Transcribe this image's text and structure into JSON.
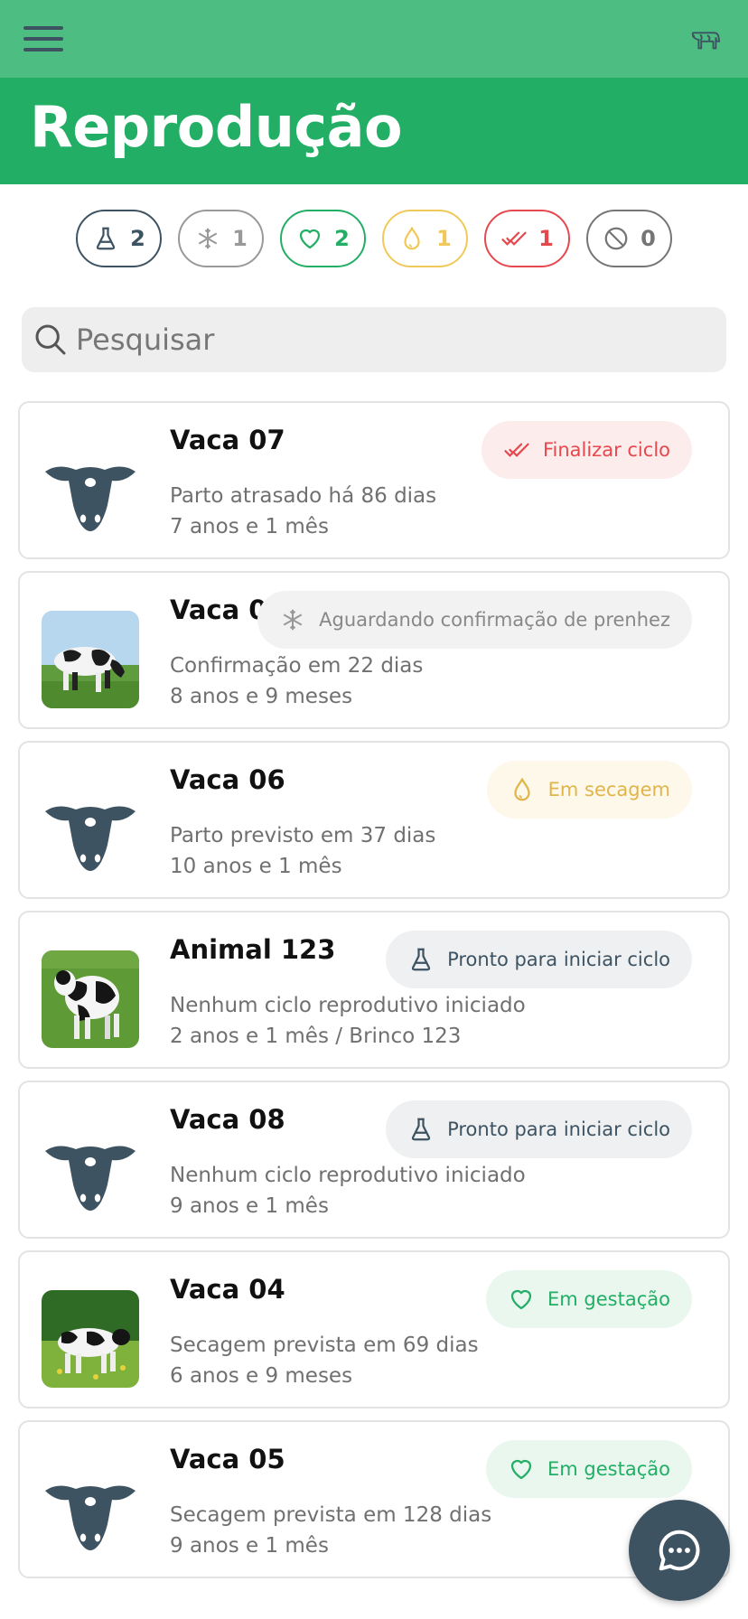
{
  "app": {
    "title": "Reprodução"
  },
  "search": {
    "placeholder": "Pesquisar"
  },
  "filters": [
    {
      "icon": "flask-icon",
      "count": "2",
      "color": "#3e5362"
    },
    {
      "icon": "snowflake-icon",
      "count": "1",
      "color": "#999999"
    },
    {
      "icon": "heart-icon",
      "count": "2",
      "color": "#23ae65"
    },
    {
      "icon": "drop-icon",
      "count": "1",
      "color": "#f0c95a"
    },
    {
      "icon": "double-check-icon",
      "count": "1",
      "color": "#e5484d"
    },
    {
      "icon": "ban-icon",
      "count": "0",
      "color": "#757575"
    }
  ],
  "animals": [
    {
      "name": "Vaca 07",
      "line1": "Parto atrasado há 86 dias",
      "line2": "7 anos e 1 mês",
      "status": "Finalizar ciclo",
      "status_icon": "double-check-icon",
      "photo": "cow-silhouette"
    },
    {
      "name": "Vaca 02",
      "line1": "Confirmação em 22 dias",
      "line2": "8 anos e 9 meses",
      "status": "Aguardando confirmação de prenhez",
      "status_icon": "snowflake-icon",
      "photo": "cow-photo"
    },
    {
      "name": "Vaca 06",
      "line1": "Parto previsto em 37 dias",
      "line2": "10 anos e 1 mês",
      "status": "Em secagem",
      "status_icon": "drop-icon",
      "photo": "cow-silhouette"
    },
    {
      "name": "Animal 123",
      "line1": "Nenhum ciclo reprodutivo iniciado",
      "line2": "2 anos e 1 mês / Brinco 123",
      "status": "Pronto para iniciar ciclo",
      "status_icon": "flask-icon",
      "photo": "cow-photo"
    },
    {
      "name": "Vaca 08",
      "line1": "Nenhum ciclo reprodutivo iniciado",
      "line2": "9 anos e 1 mês",
      "status": "Pronto para iniciar ciclo",
      "status_icon": "flask-icon",
      "photo": "cow-silhouette"
    },
    {
      "name": "Vaca 04",
      "line1": "Secagem prevista em 69 dias",
      "line2": "6 anos e 9 meses",
      "status": "Em gestação",
      "status_icon": "heart-icon",
      "photo": "cow-photo"
    },
    {
      "name": "Vaca 05",
      "line1": "Secagem prevista em 128 dias",
      "line2": "9 anos e 1 mês",
      "status": "Em gestação",
      "status_icon": "heart-icon",
      "photo": "cow-silhouette"
    }
  ],
  "colors": {
    "topbar": "#4dbd81",
    "header": "#23ae65",
    "dark": "#3e5362",
    "red": "#e5484d",
    "grey": "#999999",
    "yellow": "#f0c95a",
    "green": "#23ae65"
  }
}
